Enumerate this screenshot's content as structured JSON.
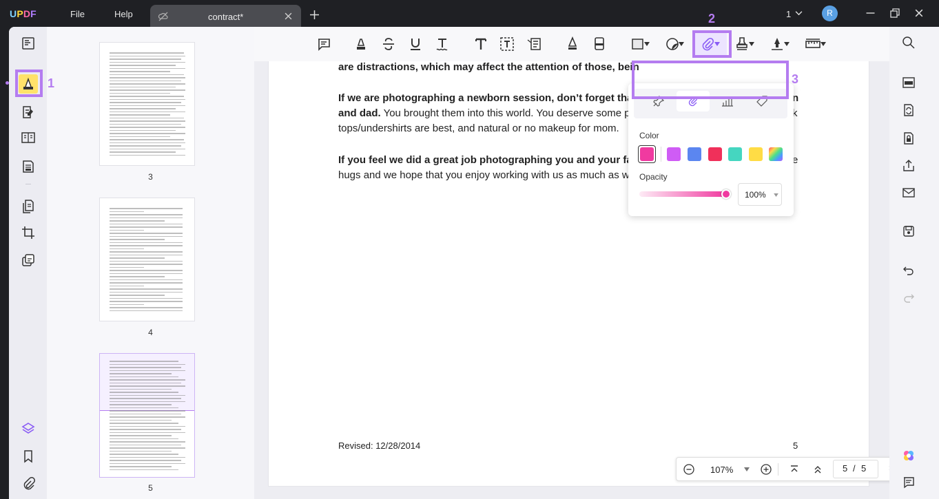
{
  "app": {
    "brand": "UPDF",
    "menu": [
      "File",
      "Help"
    ],
    "tab_title": "contract*",
    "page_count_indicator": "1",
    "user_initial": "R"
  },
  "thumbnails": [
    {
      "page": "3"
    },
    {
      "page": "4"
    },
    {
      "page": "5"
    }
  ],
  "document": {
    "line1": "are distractions, which may affect the attention of those, bein",
    "para2_bold": "If we are photographing a newborn session, don’t forget tha",
    "para2_bold_tail": "n",
    "para2_line2_bold": "and dad.",
    "para2_line2": " You brought them into this world. You deserve some p",
    "para2_line2_tail": "k",
    "para2_line3": "tops/undershirts are best, and natural or no makeup for mom.",
    "para3_bold": "If you feel we did a great job photographing you and your fa",
    "para3_tail": "e",
    "para3_line2": "hugs and we hope that you enjoy working with us as much as we",
    "footer_left": "Revised: 12/28/2014",
    "footer_right": "5"
  },
  "popup": {
    "color_label": "Color",
    "opacity_label": "Opacity",
    "opacity_value": "100%",
    "opacity": 1.0,
    "colors": [
      "#f03aa0",
      "#cf5cf5",
      "#5b86f0",
      "#f0305a",
      "#45d6c0",
      "#ffdc45",
      "rainbow"
    ],
    "selected_color": "#f03aa0",
    "tabs": [
      "pin-icon",
      "paperclip-icon",
      "chart-icon",
      "tag-icon"
    ],
    "selected_tab": "paperclip-icon"
  },
  "bottom": {
    "zoom": "107%",
    "current_page": "5",
    "separator": "/",
    "total_pages": "5"
  },
  "annotations": {
    "n1": "1",
    "n2": "2",
    "n3": "3"
  },
  "colors": {
    "accent": "#b47cf0",
    "titlebar": "#1f2024"
  }
}
